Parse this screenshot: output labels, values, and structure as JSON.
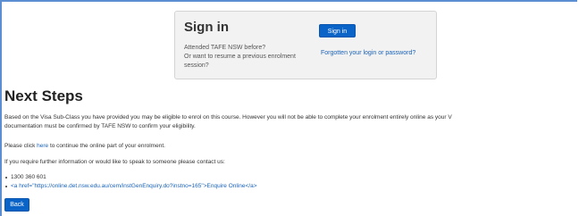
{
  "signin": {
    "title": "Sign in",
    "button_label": "Sign in",
    "desc_line1": "Attended TAFE NSW before?",
    "desc_line2": "Or want to resume a previous enrolment",
    "desc_line3": "session?",
    "forgot_link": "Forgotten your login or password?"
  },
  "main": {
    "heading": "Next Steps",
    "para1_line1": "Based on the Visa Sub-Class you have provided you may be eligible to enrol on this course. However you will not be able to complete your enrolment entirely online as your V",
    "para1_line2": "documentation must be confirmed by TAFE NSW to confirm your eligibility.",
    "para2_before": "Please click ",
    "para2_link": "here",
    "para2_after": " to continue the online part of your enrolment.",
    "para3": "If you require further information or would like to speak to someone please contact us:",
    "contact_phone": "1300 360 601",
    "contact_enquire": "<a href=\"https://online.det.nsw.edu.au/cem/instGenEnquiry.do?instno=165\">Enquire Online</a>",
    "back_label": "Back"
  }
}
